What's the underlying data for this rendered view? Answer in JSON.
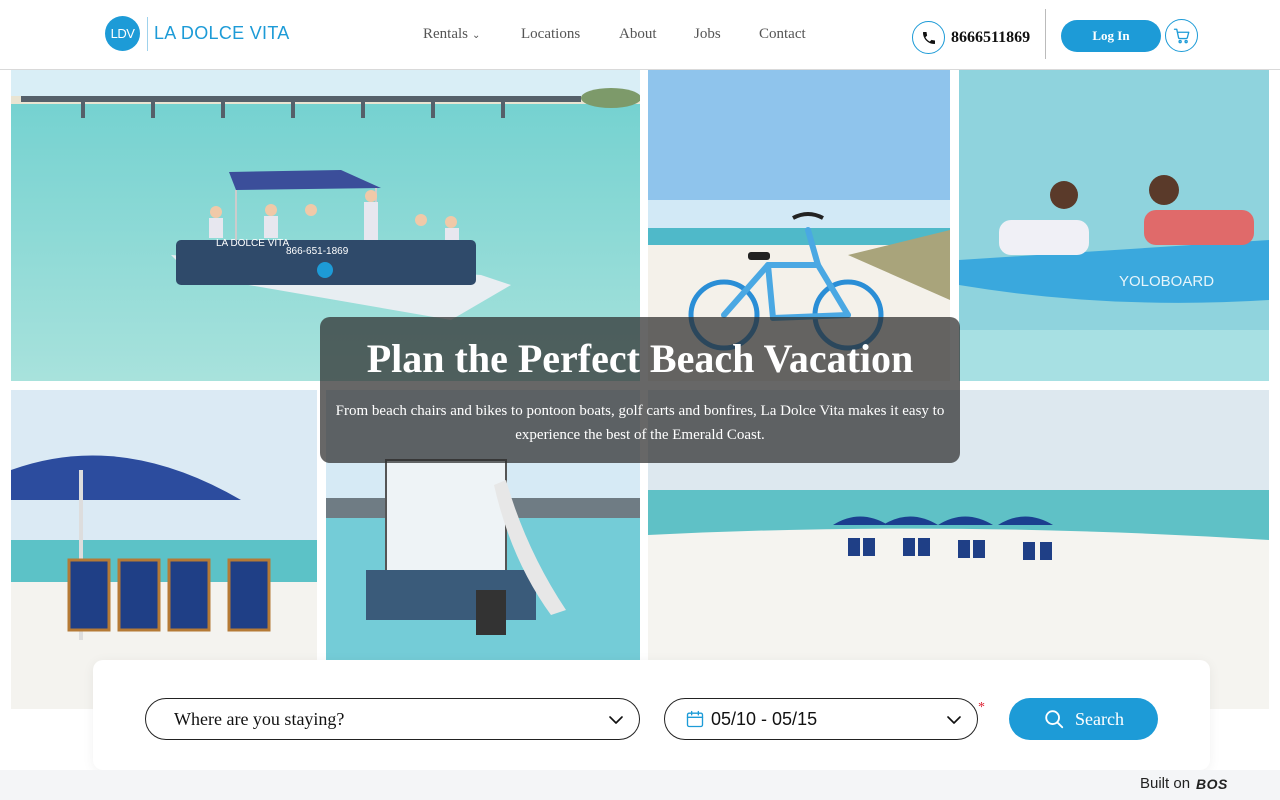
{
  "brand": {
    "logo_mark": "LDV",
    "name": "LA DOLCE VITA"
  },
  "nav": [
    {
      "label": "Rentals",
      "has_caret": true,
      "caret": "⌄"
    },
    {
      "label": "Locations"
    },
    {
      "label": "About"
    },
    {
      "label": "Jobs"
    },
    {
      "label": "Contact"
    }
  ],
  "contact": {
    "phone_icon": "phone-icon",
    "phone_number": "8666511869"
  },
  "auth": {
    "login_label": "Log In",
    "cart_icon": "cart-icon"
  },
  "hero": {
    "title": "Plan the Perfect Beach Vacation",
    "subtitle": "From beach chairs and bikes to pontoon boats, golf carts and bonfires, La Dolce Vita makes it easy to experience the best of the Emerald Coast."
  },
  "photos": {
    "boat_printed_name": "LA DOLCE VITA",
    "boat_printed_phone": "866-651-1869",
    "paddleboard_printed_brand": "YOLOBOARD"
  },
  "search": {
    "location_placeholder": "Where are you staying?",
    "dates_value": "05/10 - 05/15",
    "required_mark": "*",
    "search_label": "Search"
  },
  "footer": {
    "built_on_label": "Built on",
    "platform_logo": "BOS"
  },
  "colors": {
    "accent": "#1d9bd7",
    "overlay": "rgba(45,45,45,0.72)",
    "required": "#dd2233"
  }
}
